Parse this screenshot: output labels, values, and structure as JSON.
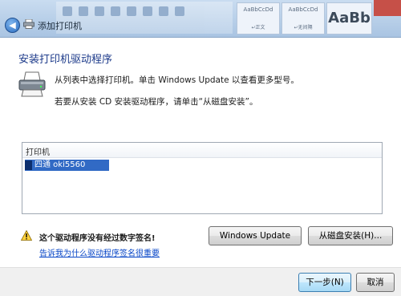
{
  "window": {
    "title": "添加打印机",
    "back_glyph": "◀"
  },
  "ribbon": {
    "style_swatches": [
      {
        "sample": "AaBbCcDd",
        "name": "↵正文"
      },
      {
        "sample": "AaBbCcDd",
        "name": "↵无间隔"
      },
      {
        "sample": "AaBb",
        "name": ""
      }
    ]
  },
  "main": {
    "heading": "安装打印机驱动程序",
    "instruction_1": "从列表中选择打印机。单击 Windows Update 以查看更多型号。",
    "instruction_2": "若要从安装 CD 安装驱动程序，请单击“从磁盘安装”。"
  },
  "printer_list": {
    "header": "打印机",
    "items": [
      {
        "label": "四通 oki5560",
        "selected": true
      }
    ]
  },
  "warning": {
    "text": "这个驱动程序没有经过数字签名!",
    "link": "告诉我为什么驱动程序签名很重要"
  },
  "buttons": {
    "windows_update": "Windows Update",
    "from_disk": "从磁盘安装(H)...",
    "next": "下一步(N)",
    "cancel": "取消"
  },
  "colors": {
    "heading": "#1c3a8a",
    "selection": "#316ac5",
    "link": "#0645c7"
  }
}
